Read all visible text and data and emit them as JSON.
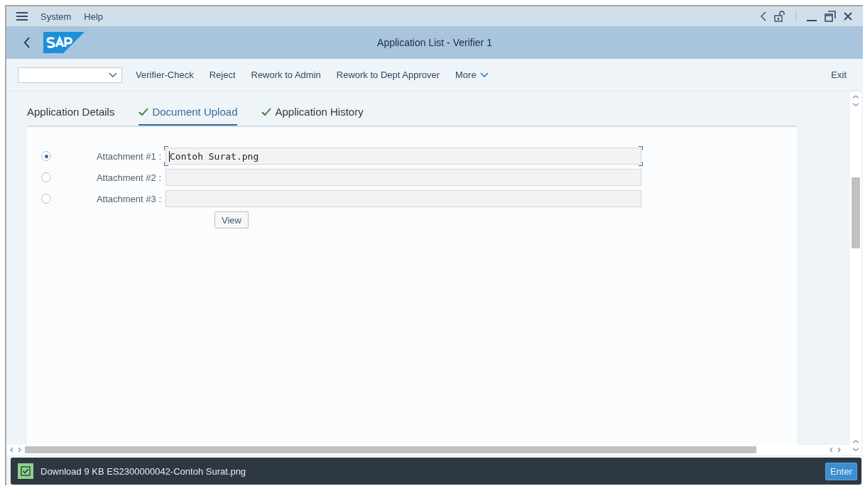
{
  "menu": [
    "System",
    "Help"
  ],
  "window": {
    "title": "Application List - Verifier 1"
  },
  "toolbar": {
    "buttons": [
      "Verifier-Check",
      "Reject",
      "Rework to Admin",
      "Rework to Dept Approver"
    ],
    "more": "More",
    "exit": "Exit"
  },
  "tabs": [
    {
      "label": "Application Details",
      "selected": false,
      "completed": false
    },
    {
      "label": "Document Upload",
      "selected": true,
      "completed": true
    },
    {
      "label": "Application History",
      "selected": false,
      "completed": true
    }
  ],
  "attachments": [
    {
      "label": "Attachment #1 :",
      "selected": true,
      "value": "Contoh Surat.png",
      "focused": true
    },
    {
      "label": "Attachment #2 :",
      "selected": false,
      "focused": false
    },
    {
      "label": "Attachment #3 :",
      "selected": false,
      "focused": false
    }
  ],
  "view_button": "View",
  "status_bar": {
    "message": "Download 9 KB ES2300000042-Contoh Surat.png",
    "success": true,
    "button": "Enter"
  }
}
